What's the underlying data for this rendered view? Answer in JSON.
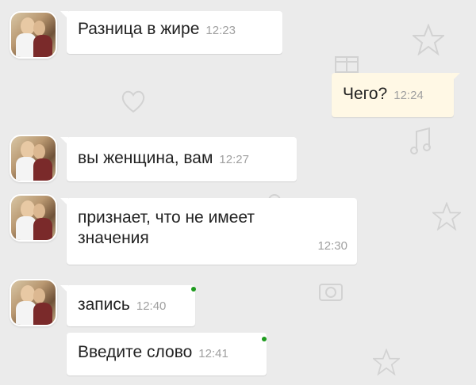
{
  "chat": {
    "messages": [
      {
        "side": "in",
        "text": "Разница в жире",
        "time": "12:23"
      },
      {
        "side": "out",
        "text": "Чего?",
        "time": "12:24"
      },
      {
        "side": "in",
        "text": "вы женщина, вам",
        "time": "12:27"
      },
      {
        "side": "in",
        "text_line1": "признает, что не имеет",
        "text_line2": "значения",
        "time": "12:30"
      },
      {
        "side": "in",
        "text": "запись",
        "time": "12:40"
      },
      {
        "side": "in",
        "text": "Введите слово",
        "time": "12:41"
      }
    ]
  },
  "colors": {
    "background": "#ebebeb",
    "incoming_bubble": "#ffffff",
    "outgoing_bubble": "#fff8e5",
    "online_dot": "#1e9b1e",
    "time_text": "#a0a0a0"
  },
  "icons": [
    "avatar",
    "online-dot"
  ]
}
